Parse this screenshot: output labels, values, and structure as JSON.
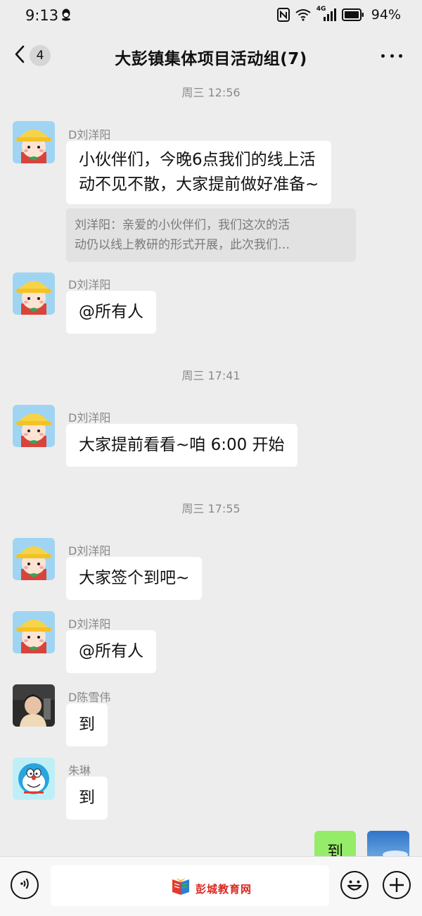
{
  "status_bar": {
    "time": "9:13",
    "battery": "94%",
    "network": "4G",
    "icons": [
      "qq-icon",
      "nfc-icon",
      "wifi-icon",
      "signal-icon",
      "battery-icon"
    ]
  },
  "nav": {
    "back_badge": "4",
    "title": "大彭镇集体项目活动组(7)"
  },
  "messages": {
    "ts1": "周三 12:56",
    "m1": {
      "sender": "D刘洋阳",
      "line1": "小伙伴们，今晚6点我们的线上活",
      "line2": "动不见不散，大家提前做好准备~",
      "quote1": "刘洋阳：亲爱的小伙伴们，我们这次的活",
      "quote2": "动仍以线上教研的形式开展，此次我们…"
    },
    "m2": {
      "sender": "D刘洋阳",
      "text": "@所有人"
    },
    "ts2": "周三 17:41",
    "m3": {
      "sender": "D刘洋阳",
      "text": "大家提前看看~咱 6:00 开始"
    },
    "ts3": "周三 17:55",
    "m4": {
      "sender": "D刘洋阳",
      "text": "大家签个到吧~"
    },
    "m5": {
      "sender": "D刘洋阳",
      "text": "@所有人"
    },
    "m6": {
      "sender": "D陈雪伟",
      "text": "到"
    },
    "m7": {
      "sender": "朱琳",
      "text": "到"
    },
    "m8": {
      "text": "到"
    }
  },
  "bottom": {
    "watermark": "彭城教育网"
  },
  "colors": {
    "background": "#ededed",
    "bubble": "#ffffff",
    "my_bubble": "#95ec69",
    "quote_bg": "#e2e2e2"
  }
}
